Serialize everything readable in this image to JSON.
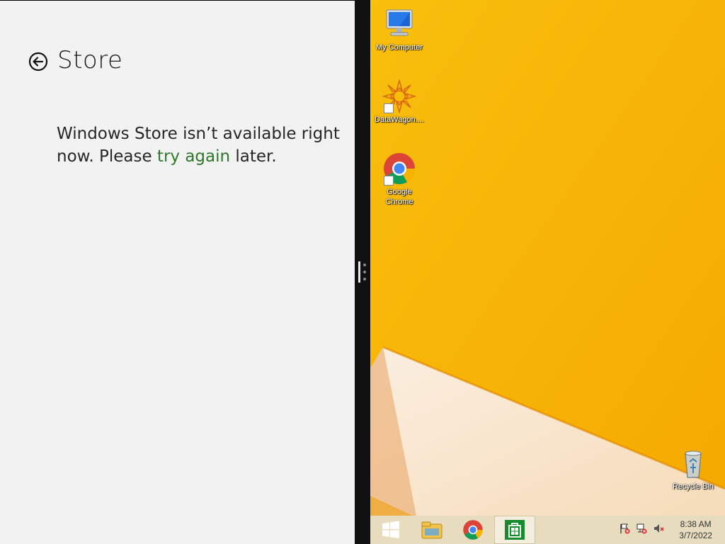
{
  "store": {
    "title": "Store",
    "message_part1": "Windows Store isn’t available right now. Please ",
    "message_link": "try again",
    "message_part2": " later."
  },
  "desktop": {
    "icons": [
      {
        "label": "My Computer"
      },
      {
        "label": "DataWagon...."
      },
      {
        "label": "Google Chrome"
      },
      {
        "label": "Recycle Bin"
      }
    ]
  },
  "taskbar": {
    "buttons": [
      {
        "name": "start",
        "icon": "windows-logo-icon"
      },
      {
        "name": "file-explorer",
        "icon": "folder-icon"
      },
      {
        "name": "chrome",
        "icon": "chrome-icon"
      },
      {
        "name": "store",
        "icon": "store-icon"
      }
    ],
    "clock": {
      "time": "8:38 AM",
      "date": "3/7/2022"
    }
  },
  "colors": {
    "store_bg": "#f2f2f2",
    "link": "#2c7a2a",
    "desktop_bg": "#f7b500",
    "taskbar_bg": "#e8dcbf"
  }
}
